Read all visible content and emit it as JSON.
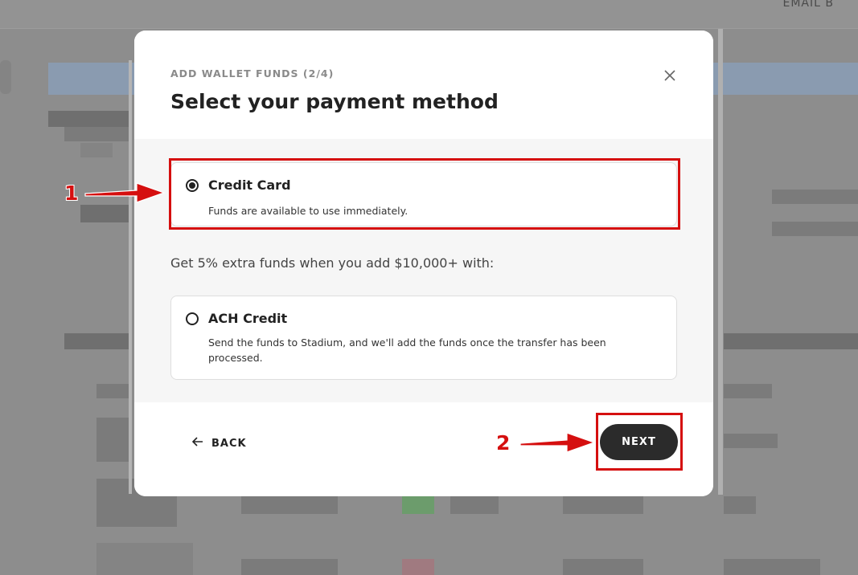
{
  "background": {
    "topbar_text": "EMAIL   B"
  },
  "modal": {
    "step_label": "ADD WALLET FUNDS (2/4)",
    "title": "Select your payment method",
    "close_icon": "close-icon",
    "options": [
      {
        "title": "Credit Card",
        "description": "Funds are available to use immediately.",
        "selected": true
      },
      {
        "title": "ACH Credit",
        "description": "Send the funds to Stadium, and we'll add the funds once the transfer has been processed.",
        "selected": false
      }
    ],
    "promo_text": "Get 5% extra funds when you add $10,000+ with:",
    "back_label": "BACK",
    "back_icon": "arrow-left-icon",
    "next_label": "NEXT"
  },
  "annotations": {
    "step1": "1",
    "step2": "2",
    "color": "#d50f0f"
  }
}
